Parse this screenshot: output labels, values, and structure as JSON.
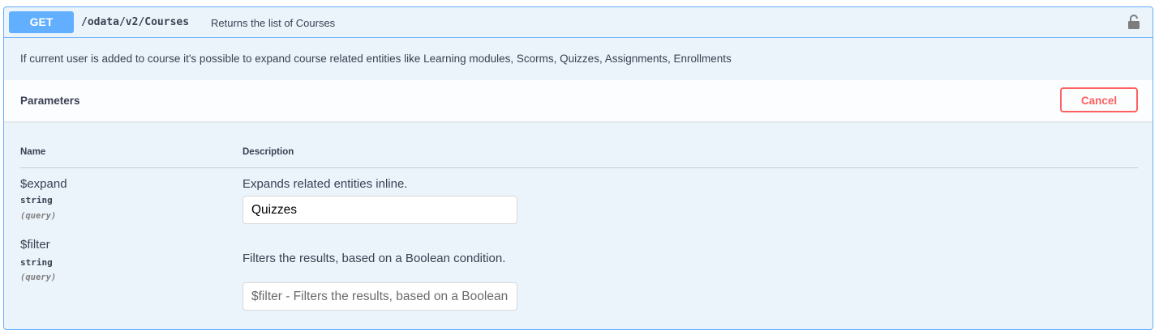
{
  "operation": {
    "method": "GET",
    "path": "/odata/v2/Courses",
    "summary": "Returns the list of Courses",
    "description": "If current user is added to course it's possible to expand course related entities like Learning modules, Scorms, Quizzes, Assignments, Enrollments",
    "lock_icon": "lock-icon",
    "colors": {
      "method_bg": "#61affe",
      "block_bg": "#ebf3fb",
      "cancel": "#ff6060"
    }
  },
  "parameters": {
    "title": "Parameters",
    "cancel_label": "Cancel",
    "col_name": "Name",
    "col_description": "Description",
    "items": [
      {
        "name": "$expand",
        "type": "string",
        "in": "(query)",
        "description": "Expands related entities inline.",
        "value": "Quizzes",
        "placeholder": ""
      },
      {
        "name": "$filter",
        "type": "string",
        "in": "(query)",
        "description": "Filters the results, based on a Boolean condition.",
        "value": "",
        "placeholder": "$filter - Filters the results, based on a Boolean condition."
      }
    ]
  }
}
